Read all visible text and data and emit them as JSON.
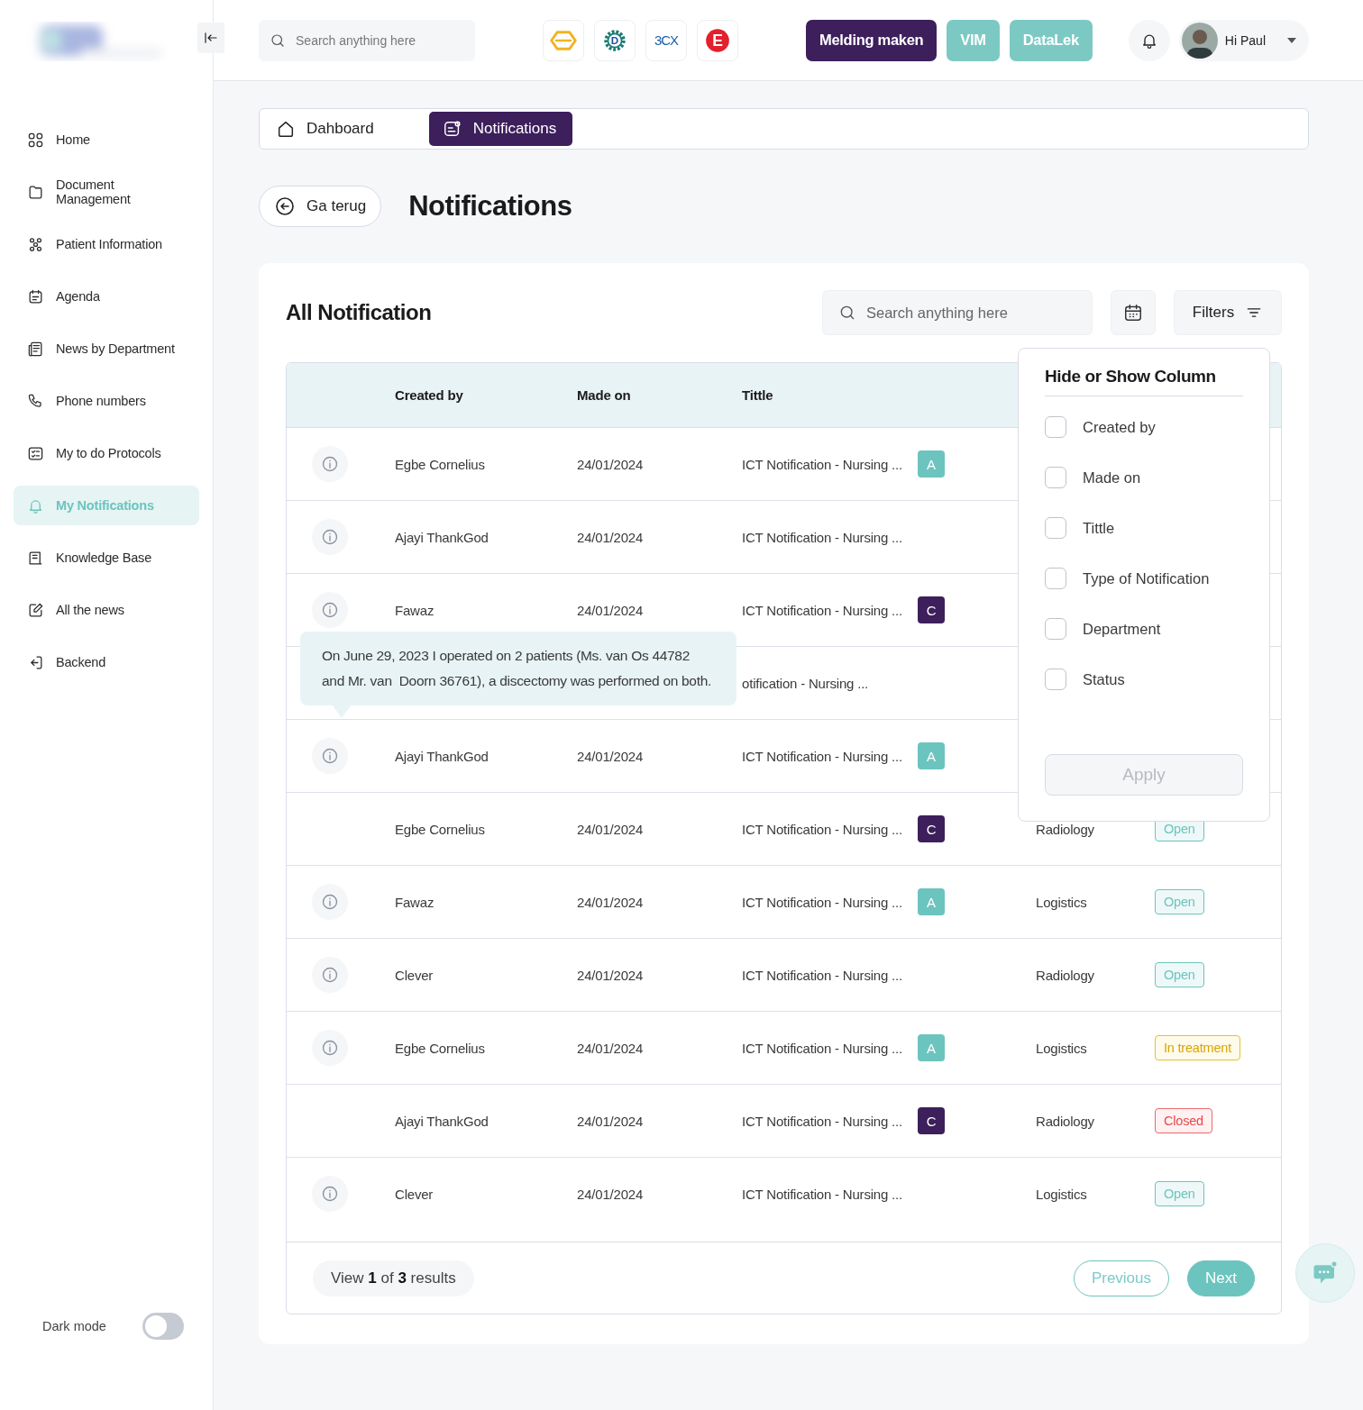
{
  "sidebar": {
    "items": [
      {
        "label": "Home",
        "selected": false
      },
      {
        "label": "Document Management",
        "selected": false
      },
      {
        "label": "Patient Information",
        "selected": false
      },
      {
        "label": "Agenda",
        "selected": false
      },
      {
        "label": "News by Department",
        "selected": false
      },
      {
        "label": "Phone numbers",
        "selected": false
      },
      {
        "label": "My to do Protocols",
        "selected": false
      },
      {
        "label": "My Notifications",
        "selected": true
      },
      {
        "label": "Knowledge Base",
        "selected": false
      },
      {
        "label": "All the news",
        "selected": false
      },
      {
        "label": "Backend",
        "selected": false
      }
    ],
    "dark_mode": {
      "label": "Dark mode",
      "on": false
    }
  },
  "topbar": {
    "search": {
      "placeholder": "Search anything here"
    },
    "app_icons": [
      {
        "kind": "hexagon"
      },
      {
        "kind": "gear",
        "label": "D"
      },
      {
        "kind": "text",
        "label": "3CX"
      },
      {
        "kind": "circle",
        "label": "E"
      }
    ],
    "buttons": [
      {
        "label": "Melding maken",
        "kind": "primary"
      },
      {
        "label": "VIM",
        "kind": "secondary"
      },
      {
        "label": "DataLek",
        "kind": "secondary"
      }
    ],
    "user": {
      "greeting": "Hi Paul"
    }
  },
  "tabs": [
    {
      "label": "Dahboard",
      "selected": false
    },
    {
      "label": "Notifications",
      "selected": true
    }
  ],
  "back_button": "Ga terug",
  "page_title": "Notifications",
  "card": {
    "title": "All Notification",
    "search": {
      "placeholder": "Search anything here"
    },
    "filters_button": "Filters",
    "table": {
      "columns": [
        "Created by",
        "Made on",
        "Tittle"
      ],
      "rows": [
        {
          "info": true,
          "created_by": "Egbe Cornelius",
          "made_on": "24/01/2024",
          "title": "ICT Notification - Nursing ...",
          "type": {
            "label": "A",
            "color": "#6cc4bf"
          }
        },
        {
          "info": true,
          "created_by": "Ajayi ThankGod",
          "made_on": "24/01/2024",
          "title": "ICT Notification - Nursing ..."
        },
        {
          "info": true,
          "created_by": "Fawaz",
          "made_on": "24/01/2024",
          "title": "ICT Notification - Nursing ...",
          "type": {
            "label": "C",
            "color": "#3d1f5c"
          }
        },
        {
          "info": false,
          "title": "otification - Nursing ..."
        },
        {
          "info": true,
          "created_by": "Ajayi ThankGod",
          "made_on": "24/01/2024",
          "title": "ICT Notification - Nursing ...",
          "type": {
            "label": "A",
            "color": "#6cc4bf"
          }
        },
        {
          "info": false,
          "created_by": "Egbe Cornelius",
          "made_on": "24/01/2024",
          "title": "ICT Notification - Nursing ...",
          "type": {
            "label": "C",
            "color": "#3d1f5c"
          },
          "department": "Radiology",
          "status": {
            "label": "Open",
            "kind": "open"
          }
        },
        {
          "info": true,
          "created_by": "Fawaz",
          "made_on": "24/01/2024",
          "title": "ICT Notification - Nursing ...",
          "type": {
            "label": "A",
            "color": "#6cc4bf"
          },
          "department": "Logistics",
          "status": {
            "label": "Open",
            "kind": "open"
          }
        },
        {
          "info": true,
          "created_by": "Clever",
          "made_on": "24/01/2024",
          "title": "ICT Notification - Nursing ...",
          "department": "Radiology",
          "status": {
            "label": "Open",
            "kind": "open"
          }
        },
        {
          "info": true,
          "created_by": "Egbe Cornelius",
          "made_on": "24/01/2024",
          "title": "ICT Notification - Nursing ...",
          "type": {
            "label": "A",
            "color": "#6cc4bf"
          },
          "department": "Logistics",
          "status": {
            "label": "In treatment",
            "kind": "treatment"
          }
        },
        {
          "info": false,
          "created_by": "Ajayi ThankGod",
          "made_on": "24/01/2024",
          "title": "ICT Notification - Nursing ...",
          "type": {
            "label": "C",
            "color": "#3d1f5c"
          },
          "department": "Radiology",
          "status": {
            "label": "Closed",
            "kind": "closed"
          }
        },
        {
          "info": true,
          "created_by": "Clever",
          "made_on": "24/01/2024",
          "title": "ICT Notification - Nursing ...",
          "department": "Logistics",
          "status": {
            "label": "Open",
            "kind": "open"
          }
        }
      ]
    },
    "tooltip": "On June 29, 2023 I operated on 2 patients (Ms. van Os 44782 and Mr. van  Doorn 36761), a discectomy was performed on both.",
    "pagination": {
      "summary": "View **1** of **3** results",
      "buttons": [
        {
          "label": "Previous",
          "disabled": true
        },
        {
          "label": "Next",
          "disabled": false
        }
      ]
    },
    "column_menu": {
      "title": "Hide or Show Column",
      "options": [
        {
          "label": "Created by",
          "checked": false
        },
        {
          "label": "Made on",
          "checked": false
        },
        {
          "label": "Tittle",
          "checked": false
        },
        {
          "label": "Type of Notification",
          "checked": false
        },
        {
          "label": "Department",
          "checked": false
        },
        {
          "label": "Status",
          "checked": false
        }
      ],
      "apply": {
        "label": "Apply",
        "disabled": true
      }
    }
  }
}
